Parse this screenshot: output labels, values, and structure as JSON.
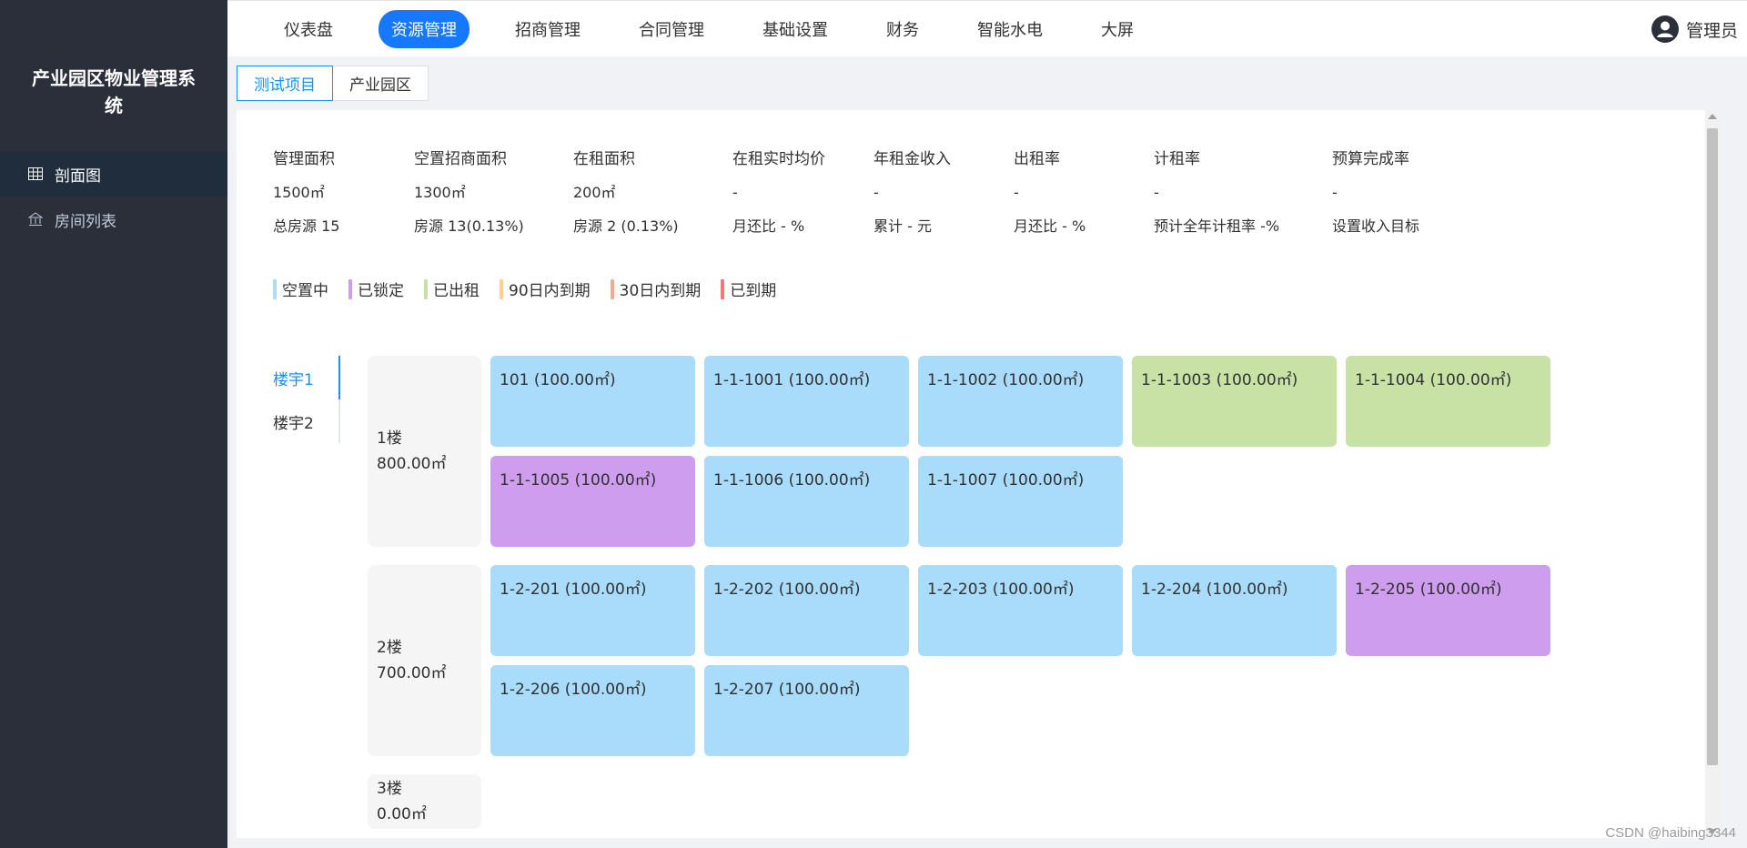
{
  "app": {
    "title": "产业园区物业管理系统"
  },
  "sidebar": {
    "items": [
      {
        "label": "剖面图",
        "icon": "grid-icon",
        "active": true
      },
      {
        "label": "房间列表",
        "icon": "bank-icon",
        "active": false
      }
    ]
  },
  "topnav": {
    "items": [
      {
        "label": "仪表盘",
        "active": false
      },
      {
        "label": "资源管理",
        "active": true
      },
      {
        "label": "招商管理",
        "active": false
      },
      {
        "label": "合同管理",
        "active": false
      },
      {
        "label": "基础设置",
        "active": false
      },
      {
        "label": "财务",
        "active": false
      },
      {
        "label": "智能水电",
        "active": false
      },
      {
        "label": "大屏",
        "active": false
      }
    ],
    "user": "管理员"
  },
  "subtabs": [
    {
      "label": "测试项目",
      "active": true
    },
    {
      "label": "产业园区",
      "active": false
    }
  ],
  "stats": [
    {
      "label": "管理面积",
      "value": "1500㎡",
      "sub": "总房源 15"
    },
    {
      "label": "空置招商面积",
      "value": "1300㎡",
      "sub": "房源 13(0.13%)"
    },
    {
      "label": "在租面积",
      "value": "200㎡",
      "sub": "房源 2 (0.13%)"
    },
    {
      "label": "在租实时均价",
      "value": "-",
      "sub": "月还比 - %"
    },
    {
      "label": "年租金收入",
      "value": "-",
      "sub": "累计 - 元"
    },
    {
      "label": "出租率",
      "value": "-",
      "sub": "月还比 - %"
    },
    {
      "label": "计租率",
      "value": "-",
      "sub": "预计全年计租率 -%"
    },
    {
      "label": "预算完成率",
      "value": "-",
      "sub": "设置收入目标"
    }
  ],
  "legend": [
    {
      "label": "空置中",
      "color": "#a8dcfa"
    },
    {
      "label": "已锁定",
      "color": "#cf9ded"
    },
    {
      "label": "已出租",
      "color": "#c8e2a6"
    },
    {
      "label": "90日内到期",
      "color": "#ffd18a"
    },
    {
      "label": "30日内到期",
      "color": "#f7a98c"
    },
    {
      "label": "已到期",
      "color": "#f27878"
    }
  ],
  "buildings": [
    {
      "label": "楼宇1",
      "active": true
    },
    {
      "label": "楼宇2",
      "active": false
    }
  ],
  "floors": [
    {
      "name": "1楼",
      "area": "800.00㎡",
      "rooms": [
        {
          "label": "101 (100.00㎡)",
          "status": "vacant"
        },
        {
          "label": "1-1-1001 (100.00㎡)",
          "status": "vacant"
        },
        {
          "label": "1-1-1002 (100.00㎡)",
          "status": "vacant"
        },
        {
          "label": "1-1-1003 (100.00㎡)",
          "status": "rented"
        },
        {
          "label": "1-1-1004 (100.00㎡)",
          "status": "rented"
        },
        {
          "label": "1-1-1005 (100.00㎡)",
          "status": "locked"
        },
        {
          "label": "1-1-1006 (100.00㎡)",
          "status": "vacant"
        },
        {
          "label": "1-1-1007 (100.00㎡)",
          "status": "vacant"
        }
      ]
    },
    {
      "name": "2楼",
      "area": "700.00㎡",
      "rooms": [
        {
          "label": "1-2-201 (100.00㎡)",
          "status": "vacant"
        },
        {
          "label": "1-2-202 (100.00㎡)",
          "status": "vacant"
        },
        {
          "label": "1-2-203 (100.00㎡)",
          "status": "vacant"
        },
        {
          "label": "1-2-204 (100.00㎡)",
          "status": "vacant"
        },
        {
          "label": "1-2-205 (100.00㎡)",
          "status": "locked"
        },
        {
          "label": "1-2-206 (100.00㎡)",
          "status": "vacant"
        },
        {
          "label": "1-2-207 (100.00㎡)",
          "status": "vacant"
        }
      ]
    },
    {
      "name": "3楼",
      "area": "0.00㎡",
      "rooms": []
    }
  ],
  "status_colors": {
    "vacant": "#a8dcfa",
    "locked": "#cf9ded",
    "rented": "#c8e2a6"
  },
  "watermark": "CSDN @haibing3344"
}
